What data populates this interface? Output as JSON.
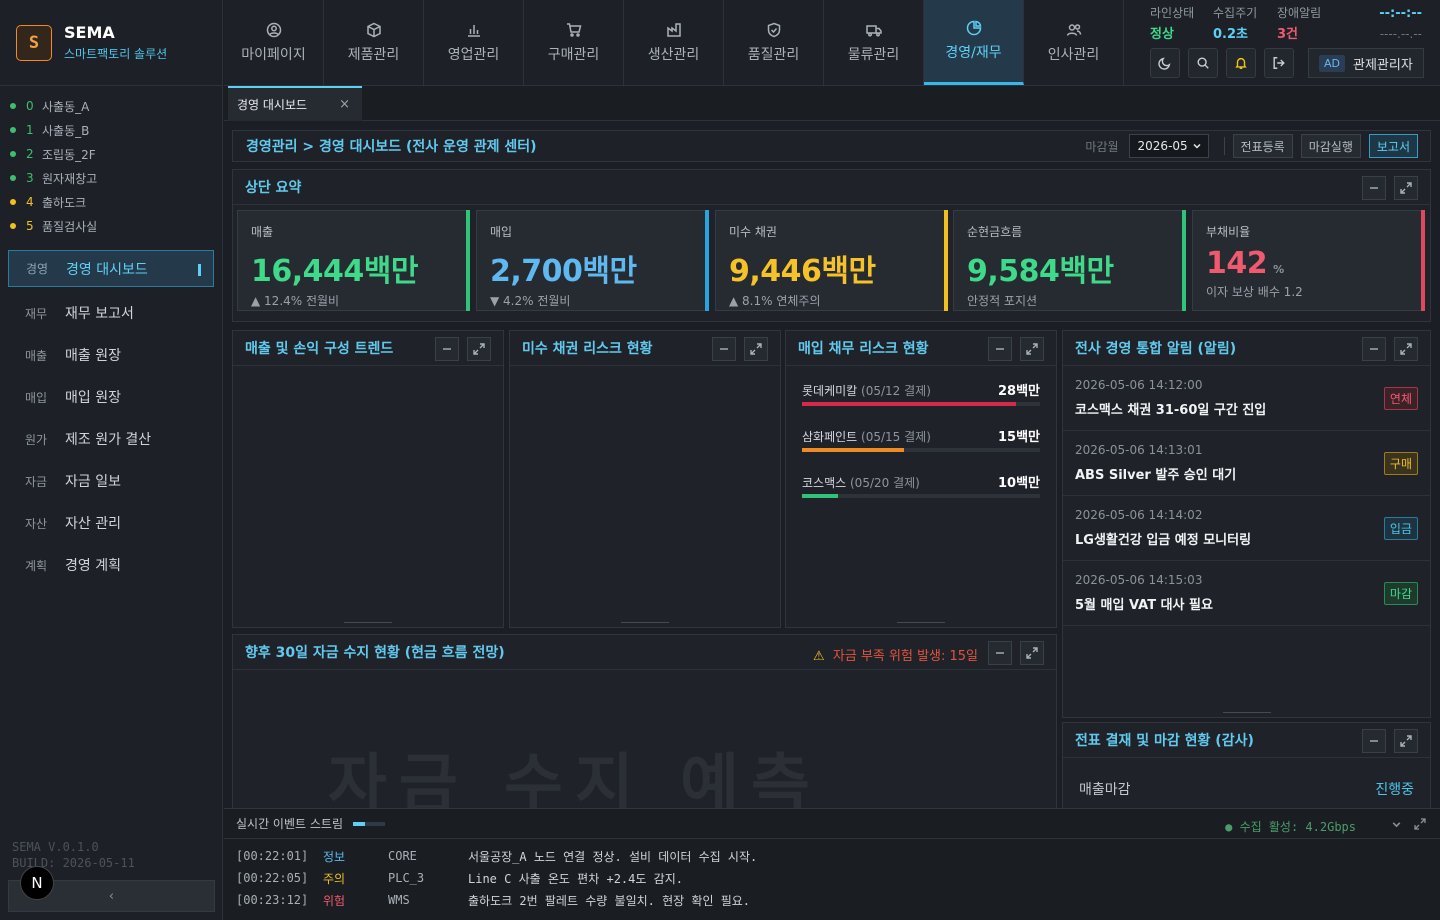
{
  "brand": {
    "letter": "S",
    "name": "SEMA",
    "subtitle": "스마트팩토리 솔루션"
  },
  "lines": [
    {
      "num": "0",
      "label": "사출동_A",
      "color": "#3fbf6a"
    },
    {
      "num": "1",
      "label": "사출동_B",
      "color": "#3fbf6a"
    },
    {
      "num": "2",
      "label": "조립동_2F",
      "color": "#3fbf6a"
    },
    {
      "num": "3",
      "label": "원자재창고",
      "color": "#3fbf6a"
    },
    {
      "num": "4",
      "label": "출하도크",
      "color": "#f0c020"
    },
    {
      "num": "5",
      "label": "품질검사실",
      "color": "#f0c020"
    }
  ],
  "menu": [
    {
      "cat": "경영",
      "label": "경영 대시보드"
    },
    {
      "cat": "재무",
      "label": "재무 보고서"
    },
    {
      "cat": "매출",
      "label": "매출 원장"
    },
    {
      "cat": "매입",
      "label": "매입 원장"
    },
    {
      "cat": "원가",
      "label": "제조 원가 결산"
    },
    {
      "cat": "자금",
      "label": "자금 일보"
    },
    {
      "cat": "자산",
      "label": "자산 관리"
    },
    {
      "cat": "계획",
      "label": "경영 계획"
    }
  ],
  "version": "SEMA V.0.1.0",
  "build": "BUILD: 2026-05-11",
  "collapse_icon": "‹",
  "nbadge": "N",
  "nav": [
    "마이페이지",
    "제품관리",
    "영업관리",
    "구매관리",
    "생산관리",
    "품질관리",
    "물류관리",
    "경영/재무",
    "인사관리"
  ],
  "status": {
    "line_label": "라인상태",
    "line_value": "정상",
    "cycle_label": "수집주기",
    "cycle_value": "0.2초",
    "alarm_label": "장애알림",
    "alarm_value": "3건",
    "clock": "--:--:--",
    "date": "----.--.--"
  },
  "admin": {
    "badge": "AD",
    "label": "관제관리자"
  },
  "tab": {
    "label": "경영 대시보드",
    "close": "×"
  },
  "breadcrumb": "경영관리 > 경영 대시보드 (전사 운영 관제 센터)",
  "toolbar": {
    "close_month_label": "마감월",
    "month": "2026-05",
    "btn1": "전표등록",
    "btn2": "마감실행",
    "btn3": "보고서"
  },
  "summary": {
    "title": "상단 요약"
  },
  "kpis": [
    {
      "label": "매출",
      "value": "16,444",
      "unit": "백만",
      "sub": "▲ 12.4% 전월비",
      "color": "#3fd98a",
      "bar": "#2fc47a"
    },
    {
      "label": "매입",
      "value": "2,700",
      "unit": "백만",
      "sub": "▼ 4.2% 전월비",
      "color": "#5fb8f0",
      "bar": "#2aa4e0"
    },
    {
      "label": "미수 채권",
      "value": "9,446",
      "unit": "백만",
      "sub": "▲ 8.1% 연체주의",
      "color": "#f5c22a",
      "bar": "#f0c020"
    },
    {
      "label": "순현금흐름",
      "value": "9,584",
      "unit": "백만",
      "sub": "안정적 포지션",
      "color": "#3fd98a",
      "bar": "#2fc47a"
    },
    {
      "label": "부채비율",
      "value": "142",
      "unit": "%",
      "sub": "이자 보상 배수 1.2",
      "color": "#f05a6e",
      "bar": "#e04860"
    }
  ],
  "panels": {
    "trend": "매출 및 손익 구성 트렌드",
    "receivable": "미수 채권 리스크 현황",
    "payable": "매입 채무 리스크 현황",
    "alerts": "전사 경영 통합 알림 (알림)",
    "cashflow": "향후 30일 자금 수지 현황 (현금 흐름 전망)",
    "cash_warning_icon": "⚠",
    "cash_warning": "자금 부족 위험 발생: 15일",
    "cash_ghost": "자금 수지 예측",
    "closing": "전표 결재 및 마감 현황 (감사)"
  },
  "payables": [
    {
      "name": "롯데케미칼",
      "date": "(05/12 결제)",
      "amount": "28백만",
      "pct": 0.9,
      "color": "#d6294e"
    },
    {
      "name": "삼화페인트",
      "date": "(05/15 결제)",
      "amount": "15백만",
      "pct": 0.43,
      "color": "#f08a24"
    },
    {
      "name": "코스맥스",
      "date": "(05/20 결제)",
      "amount": "10백만",
      "pct": 0.15,
      "color": "#2fc47a"
    }
  ],
  "alerts": [
    {
      "time": "2026-05-06 14:12:00",
      "msg": "코스맥스 채권 31-60일 구간 진입",
      "tag": "연체",
      "color": "#f05a6e"
    },
    {
      "time": "2026-05-06 14:13:01",
      "msg": "ABS Silver 발주 승인 대기",
      "tag": "구매",
      "color": "#f0c020"
    },
    {
      "time": "2026-05-06 14:14:02",
      "msg": "LG생활건강 입금 예정 모니터링",
      "tag": "입금",
      "color": "#4fc3e9"
    },
    {
      "time": "2026-05-06 14:15:03",
      "msg": "5월 매입 VAT 대사 필요",
      "tag": "마감",
      "color": "#3fd98a"
    }
  ],
  "closing": {
    "label": "매출마감",
    "status": "진행중"
  },
  "events": {
    "title": "실시간 이벤트 스트림",
    "live": "● 수집 활성: 4.2Gbps",
    "rows": [
      {
        "ts": "[00:22:01]",
        "level": "정보",
        "src": "CORE",
        "msg": "서울공장_A 노드 연결 정상. 설비 데이터 수집 시작.",
        "color": "#5fb8f0"
      },
      {
        "ts": "[00:22:05]",
        "level": "주의",
        "src": "PLC_3",
        "msg": "Line C 사출 온도 편차 +2.4도 감지.",
        "color": "#f0c020"
      },
      {
        "ts": "[00:23:12]",
        "level": "위험",
        "src": "WMS",
        "msg": "출하도크 2번 팔레트 수량 불일치. 현장 확인 필요.",
        "color": "#f05a6e"
      }
    ]
  }
}
